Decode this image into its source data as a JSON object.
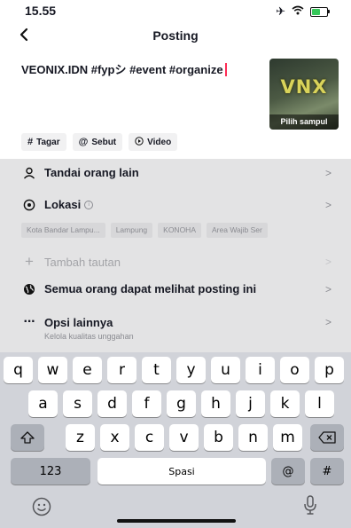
{
  "status": {
    "time": "15.55",
    "battery_level": 0.55
  },
  "nav": {
    "title": "Posting"
  },
  "caption": {
    "text": "VEONIX.IDN #fypシ #event #organize"
  },
  "cover": {
    "logo_text": "VNX",
    "button_label": "Pilih sampul"
  },
  "chips": [
    {
      "icon": "#",
      "label": "Tagar"
    },
    {
      "icon": "@",
      "label": "Sebut"
    },
    {
      "icon": "▷",
      "label": "Video"
    }
  ],
  "settings": {
    "tag_people": "Tandai orang lain",
    "location": "Lokasi",
    "location_suggestions": [
      "Kota Bandar Lampu...",
      "Lampung",
      "KONOHA",
      "Area Wajib Ser"
    ],
    "add_link": "Tambah tautan",
    "privacy": "Semua orang dapat melihat posting ini",
    "more_options": "Opsi lainnya",
    "more_options_sub": "Kelola kualitas unggahan"
  },
  "keyboard": {
    "row1": [
      "q",
      "w",
      "e",
      "r",
      "t",
      "y",
      "u",
      "i",
      "o",
      "p"
    ],
    "row2": [
      "a",
      "s",
      "d",
      "f",
      "g",
      "h",
      "j",
      "k",
      "l"
    ],
    "row3": [
      "z",
      "x",
      "c",
      "v",
      "b",
      "n",
      "m"
    ],
    "numbers_key": "123",
    "space_key": "Spasi",
    "at_key": "@",
    "hash_key": "#"
  },
  "colors": {
    "accent": "#fe2c55",
    "overlay": "#e3e3e4",
    "keyboard_bg": "#d1d3d9"
  }
}
